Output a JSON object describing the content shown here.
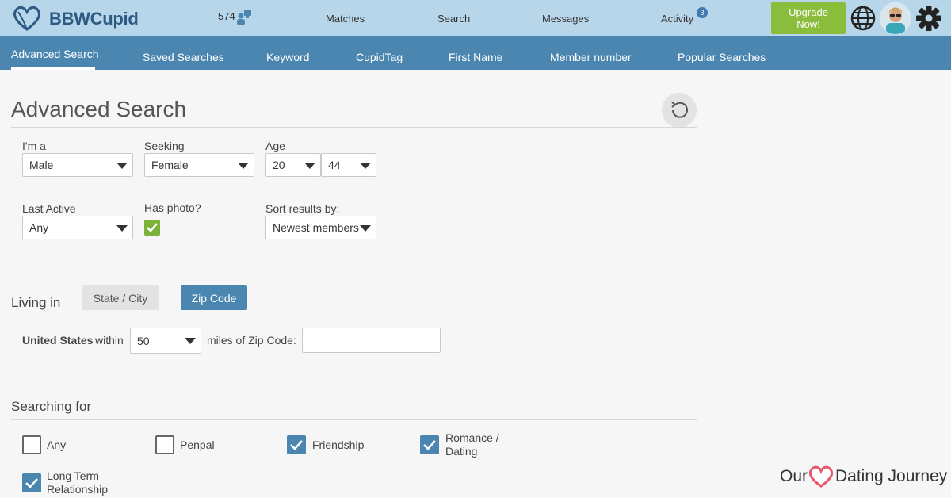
{
  "brand": {
    "name": "BBWCupid"
  },
  "header": {
    "online_count": "574",
    "nav": [
      "Matches",
      "Search",
      "Messages",
      "Activity"
    ],
    "activity_badge": "3",
    "upgrade_label": "Upgrade Now!"
  },
  "subnav": {
    "items": [
      "Advanced Search",
      "Saved Searches",
      "Keyword",
      "CupidTag",
      "First Name",
      "Member number",
      "Popular Searches"
    ],
    "active": "Advanced Search"
  },
  "page": {
    "title": "Advanced Search"
  },
  "filters": {
    "im_a": {
      "label": "I'm a",
      "value": "Male"
    },
    "seeking": {
      "label": "Seeking",
      "value": "Female"
    },
    "age": {
      "label": "Age",
      "min": "20",
      "max": "44"
    },
    "last_active": {
      "label": "Last Active",
      "value": "Any"
    },
    "has_photo": {
      "label": "Has photo?",
      "checked": true
    },
    "sort": {
      "label": "Sort results by:",
      "value": "Newest members"
    }
  },
  "living": {
    "title": "Living in",
    "tabs": [
      "State / City",
      "Zip Code"
    ],
    "active_tab": "Zip Code",
    "country": "United States",
    "within_label": "within",
    "distance": "50",
    "miles_label": "miles of Zip Code:",
    "zip_value": ""
  },
  "searching_for": {
    "title": "Searching for",
    "options": [
      {
        "label": "Any",
        "checked": false
      },
      {
        "label": "Penpal",
        "checked": false
      },
      {
        "label": "Friendship",
        "checked": true
      },
      {
        "label": "Romance / Dating",
        "checked": true
      },
      {
        "label": "Long Term Relationship",
        "checked": true
      }
    ]
  },
  "watermark": {
    "prefix": "Our",
    "suffix": "Dating Journey"
  },
  "colors": {
    "topbar": "#b8d6ea",
    "subnav": "#4a86b0",
    "accent": "#4a86b0",
    "upgrade": "#8bbd3d",
    "heart": "#e8576a"
  }
}
